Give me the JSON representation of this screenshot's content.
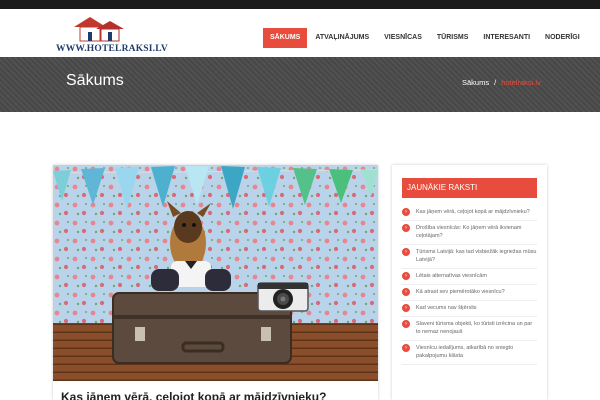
{
  "header": {
    "logo_text": "WWW.HOTELRAKSI.LV",
    "nav": [
      "SĀKUMS",
      "ATVAĻINĀJUMS",
      "VIESNĪCAS",
      "TŪRISMS",
      "INTERESANTI",
      "NODERĪGI"
    ],
    "active_nav": 0
  },
  "titlebar": {
    "title": "Sākums",
    "breadcrumb_home": "Sākums",
    "breadcrumb_separator": "/",
    "breadcrumb_current": "hotelraksi.lv"
  },
  "post": {
    "title": "Kas jāņem vērā, ceļojot kopā ar mājdzīvnieku?",
    "image_icon": "dog-on-suitcase-photo"
  },
  "sidebar": {
    "widget_title": "JAUNĀKIE RAKSTI",
    "items": [
      "Kas jāņem vērā, ceļojot kopā ar mājdzīvnieku?",
      "Drošība viesnīcās: Ko jāņem vērā ikvienam ceļotājam?",
      "Tūrisms Latvijā: kas tad visbiežāk iegriežas mūsu Latvijā?",
      "Lētais alternatīvas viesnīcām",
      "Kā atrast sev piemērotāko viesnīcu?",
      "Kad vecums nav šķērslis",
      "Slaveni tūrisma objekti, ko tūristi izrēcina un par to nemaz nenojauš",
      "Viesnīcu iedalījums, atkarībā no sniegto pakalpojumu klāsta"
    ]
  },
  "colors": {
    "accent": "#e74c3c",
    "topbar": "#1b1b1b",
    "titlebar": "#4a4a4a"
  }
}
